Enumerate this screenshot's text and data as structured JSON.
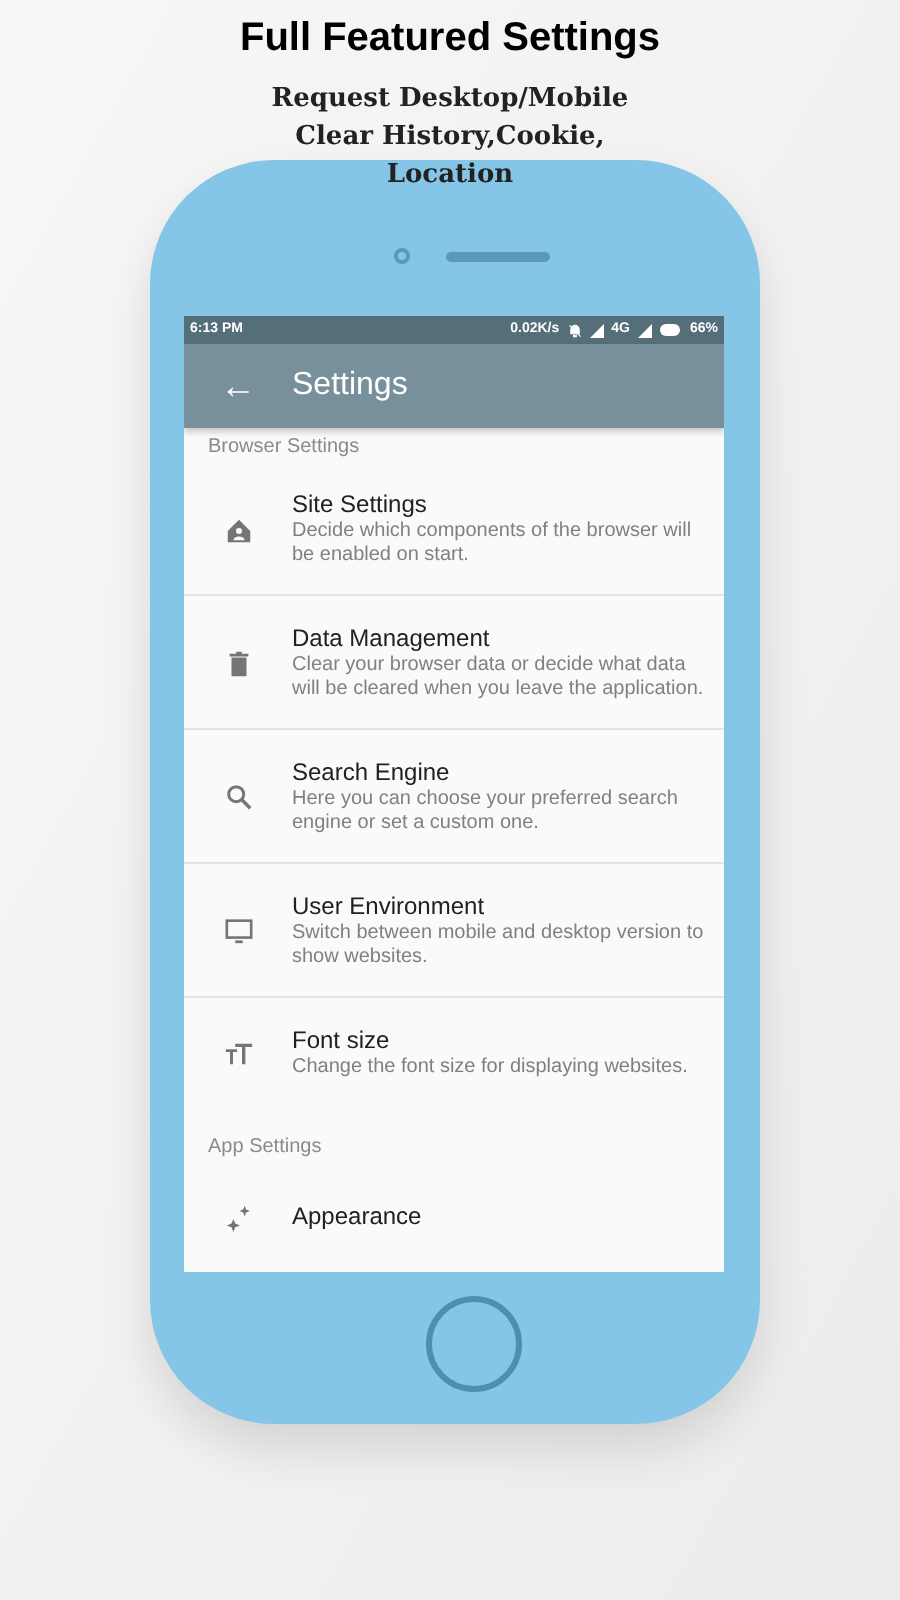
{
  "headline": "Full Featured Settings",
  "subtitle_lines": [
    "Request Desktop/Mobile",
    "Clear History,Cookie,",
    "Location"
  ],
  "status_bar": {
    "time": "6:13 PM",
    "speed": "0.02K/s",
    "network": "4G",
    "battery": "66%"
  },
  "toolbar": {
    "back": "←",
    "title": "Settings"
  },
  "sections": [
    {
      "header": "Browser Settings",
      "items": [
        {
          "kind": "home",
          "title": "Site Settings",
          "description": "Decide which components of the browser will be enabled on start."
        },
        {
          "kind": "trash",
          "title": "Data Management",
          "description": "Clear your browser data or decide what data will be cleared when you leave the application."
        },
        {
          "kind": "search",
          "title": "Search Engine",
          "description": "Here you can choose your preferred search engine or set a custom one."
        },
        {
          "kind": "monitor",
          "title": "User Environment",
          "description": "Switch between mobile and desktop version to show websites."
        },
        {
          "kind": "font",
          "title": "Font size",
          "description": "Change the font size for displaying websites."
        }
      ]
    },
    {
      "header": "App Settings",
      "items": [
        {
          "kind": "sparkle",
          "title": "Appearance"
        }
      ]
    }
  ]
}
